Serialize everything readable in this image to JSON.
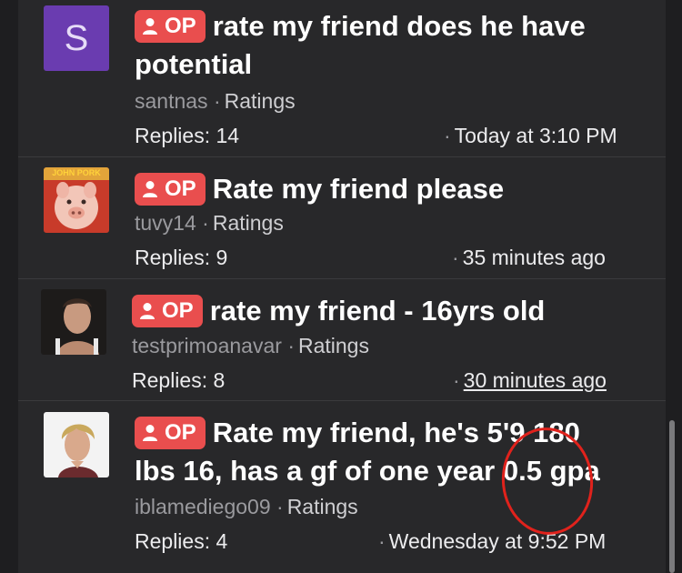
{
  "op_label": "OP",
  "threads": [
    {
      "avatar": {
        "type": "letter",
        "letter": "S",
        "color": "#6a3cb0"
      },
      "title": "rate my friend does he have potential",
      "user": "santnas",
      "forum": "Ratings",
      "replies": "Replies: 14",
      "time": "Today at 3:10 PM"
    },
    {
      "avatar": {
        "type": "image",
        "caption": "JOHN PORK"
      },
      "title": "Rate my friend please",
      "user": "tuvy14",
      "forum": "Ratings",
      "replies": "Replies: 9",
      "time": "35 minutes ago"
    },
    {
      "avatar": {
        "type": "image"
      },
      "title": "rate my friend - 16yrs old",
      "user": "testprimoanavar",
      "forum": "Ratings",
      "replies": "Replies: 8",
      "time": "30 minutes ago"
    },
    {
      "avatar": {
        "type": "image"
      },
      "title": "Rate my friend, he's 5'9 180 lbs 16, has a gf of one year 0.5 gpa",
      "user": "iblamediego09",
      "forum": "Ratings",
      "replies": "Replies: 4",
      "time": "Wednesday at 9:52 PM"
    }
  ],
  "colors": {
    "op_badge": "#e94e4e",
    "annotation_circle": "#e0221c"
  }
}
